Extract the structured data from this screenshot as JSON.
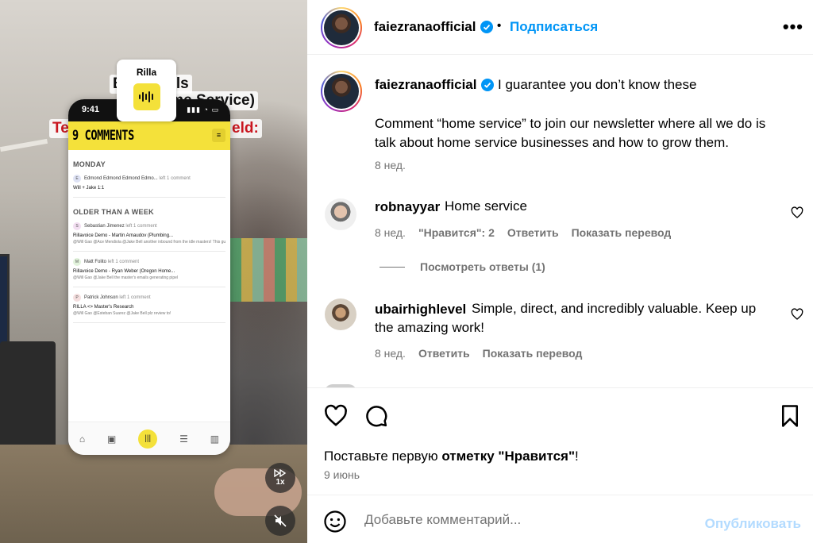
{
  "video": {
    "overlay_texts": [
      "Best Tools",
      "(for Home Service)",
      "Te",
      "eld:"
    ],
    "rilla_card": {
      "name": "Rilla"
    },
    "phone": {
      "time": "9:41",
      "header_title": "9 COMMENTS",
      "section_monday": "MONDAY",
      "section_older": "OLDER THAN A WEEK",
      "items": [
        {
          "who": "Edmond Edmond Edmond Edmo...",
          "action": "left 1 comment",
          "title": "Will + Jake 1:1",
          "detail": ""
        },
        {
          "who": "Sebastian Jimenez",
          "action": "left 1 comment",
          "title": "Rillavoice Demo - Martin Arnaudov (Plumbing...",
          "detail": "@Will Gao @Ace Mendiola @Jake Bell another inbound from the idle masters! This guy just heard of someone who was g"
        },
        {
          "who": "Matt Folito",
          "action": "left 1 comment",
          "title": "Rillavoice Demo - Ryan Weber (Oregon Home...",
          "detail": "@Will Gao @Jake Bell the master's emails generating pipel"
        },
        {
          "who": "Patrick Johnson",
          "action": "left 1 comment",
          "title": "RILLA <> Master's Research",
          "detail": "@Will Gao @Esteban Suarez @Jake Bell plz review to!"
        }
      ]
    },
    "speed_label": "1x"
  },
  "header": {
    "username": "faiezranaofficial",
    "separator": "•",
    "follow_label": "Подписаться",
    "more_label": "•••"
  },
  "caption": {
    "username": "faiezranaofficial",
    "line1": "I guarantee you don’t know these",
    "body": "Comment “home service” to join our newsletter where all we do is talk about home service businesses and how to grow them.",
    "time": "8 нед."
  },
  "comments": [
    {
      "username": "robnayyar",
      "text": "Home service",
      "time": "8 нед.",
      "likes": "\"Нравится\": 2",
      "reply": "Ответить",
      "translate": "Показать перевод",
      "view_replies": "Посмотреть ответы (1)"
    },
    {
      "username": "ubairhighlevel",
      "text": "Simple, direct, and incredibly valuable. Keep up",
      "text2": "the amazing work!",
      "time": "8 нед.",
      "reply": "Ответить",
      "translate": "Показать перевод"
    }
  ],
  "actions": {
    "likes_prefix": "Поставьте первую ",
    "likes_bold": "отметку \"Нравится\"",
    "likes_suffix": "!",
    "date": "9 июнь"
  },
  "add_comment": {
    "placeholder": "Добавьте комментарий...",
    "publish_label": "Опубликовать"
  },
  "colors": {
    "accent": "#0095f6",
    "publish_disabled": "#b3dbff",
    "secondary_text": "#737373",
    "rilla_yellow": "#f4e13a"
  },
  "icons": [
    "verified-badge-icon",
    "more-icon",
    "heart-icon",
    "comment-icon",
    "bookmark-icon",
    "emoji-icon",
    "playback-speed-icon",
    "mute-icon",
    "sound-wave-icon"
  ]
}
